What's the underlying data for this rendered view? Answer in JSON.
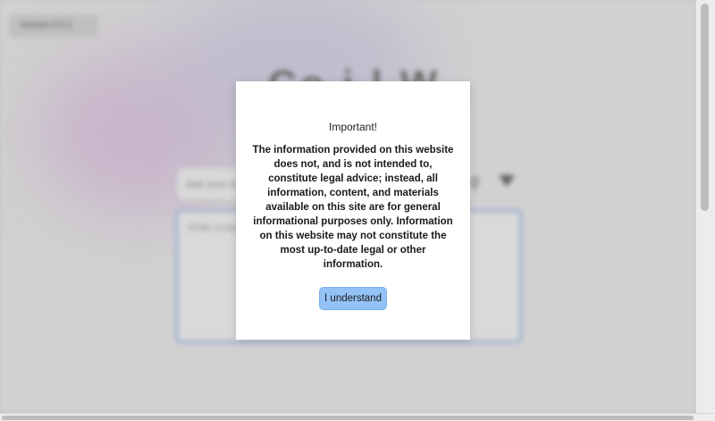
{
  "background_page": {
    "version_select": "Version 0.0.1",
    "title": "Co  i  l W",
    "search_placeholder": "Ask your le",
    "textarea_placeholder": "Enter a page",
    "search_icon": "search-icon",
    "filter_icon": "filter-icon"
  },
  "modal": {
    "title": "Important!",
    "body": "The information provided on this website does not, and is not intended to, constitute legal advice; instead, all information, content, and materials available on this site are for general informational purposes only. Information on this website may not constitute the most up-to-date legal or other information.",
    "button_label": "I understand",
    "button_color": "#93c2f7"
  }
}
